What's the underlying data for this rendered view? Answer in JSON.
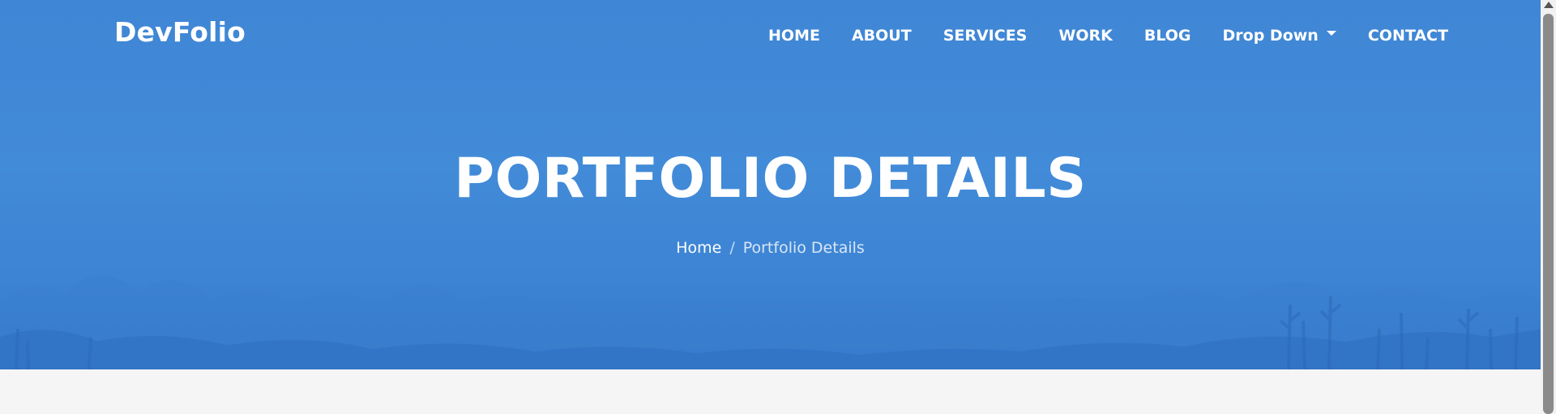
{
  "brand": {
    "name": "DevFolio"
  },
  "nav": {
    "items": [
      {
        "label": "HOME"
      },
      {
        "label": "ABOUT"
      },
      {
        "label": "SERVICES"
      },
      {
        "label": "WORK"
      },
      {
        "label": "BLOG"
      },
      {
        "label": "Drop Down",
        "icon": "caret-down-icon"
      },
      {
        "label": "CONTACT"
      }
    ]
  },
  "hero": {
    "title": "PORTFOLIO DETAILS",
    "breadcrumb": {
      "home": "Home",
      "separator": "/",
      "current": "Portfolio Details"
    }
  },
  "colors": {
    "hero_blue": "#428bd8",
    "text_white": "#ffffff",
    "page_background": "#f5f5f5"
  }
}
